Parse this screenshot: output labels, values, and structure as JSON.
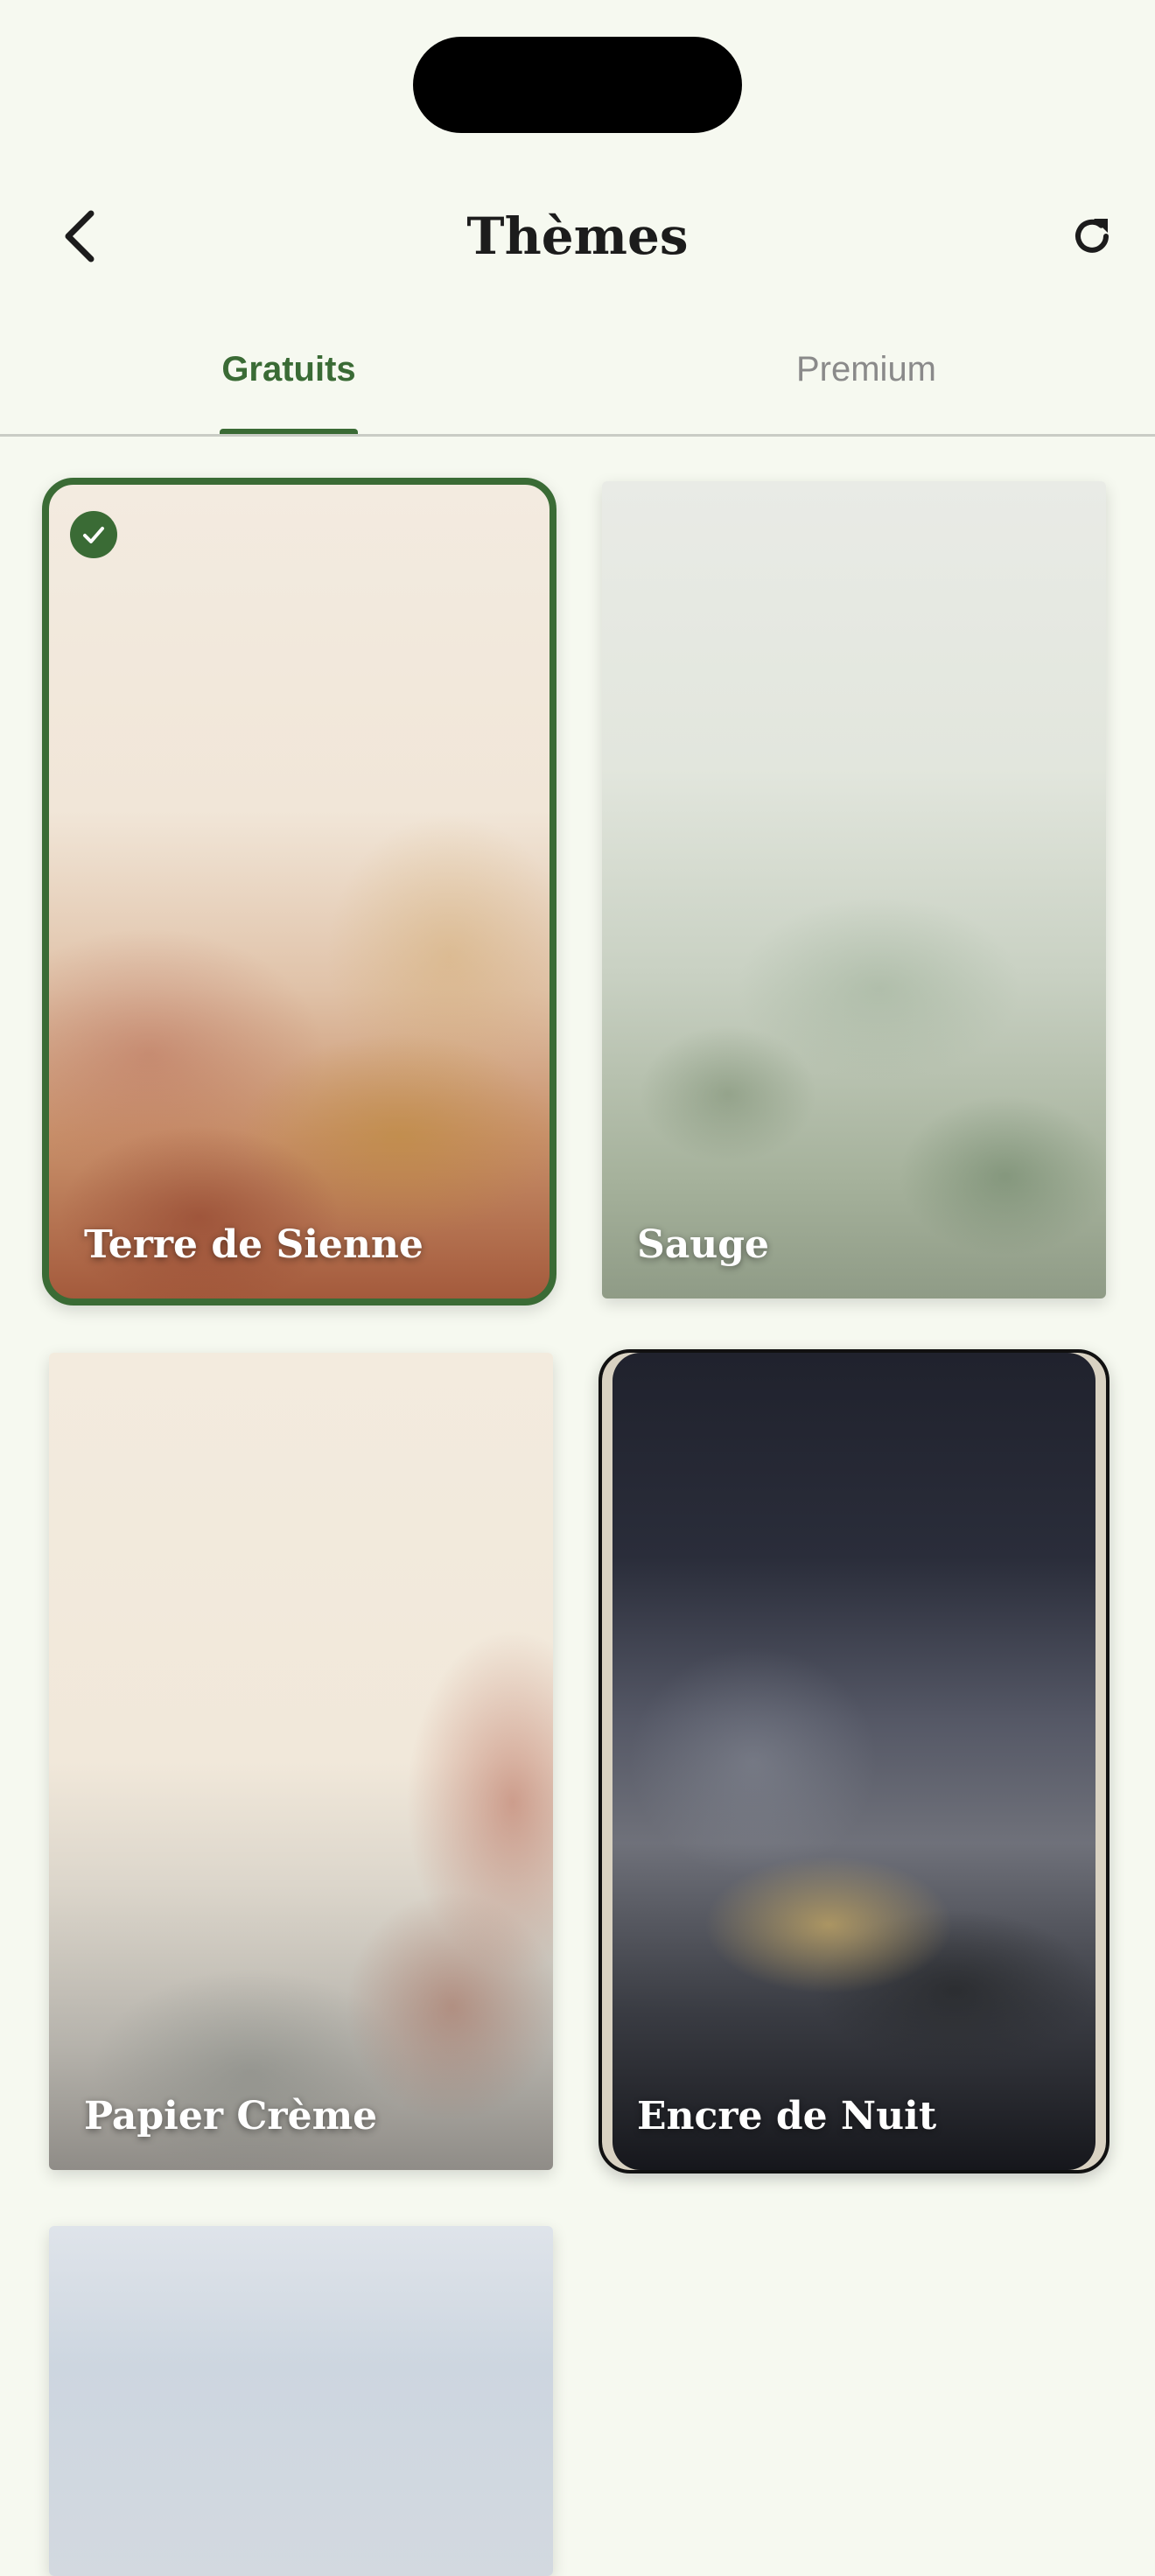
{
  "header": {
    "title": "Thèmes",
    "back_icon": "chevron-left-icon",
    "refresh_icon": "refresh-icon"
  },
  "tabs": [
    {
      "label": "Gratuits",
      "active": true
    },
    {
      "label": "Premium",
      "active": false
    }
  ],
  "themes": [
    {
      "name": "Terre de Sienne",
      "selected": true
    },
    {
      "name": "Sauge",
      "selected": false
    },
    {
      "name": "Papier Crème",
      "selected": false
    },
    {
      "name": "Encre de Nuit",
      "selected": false
    },
    {
      "name": "",
      "selected": false
    }
  ],
  "colors": {
    "accent": "#3a6b35",
    "background": "#f6f9f0",
    "inactive_tab": "#8a8a8a"
  }
}
